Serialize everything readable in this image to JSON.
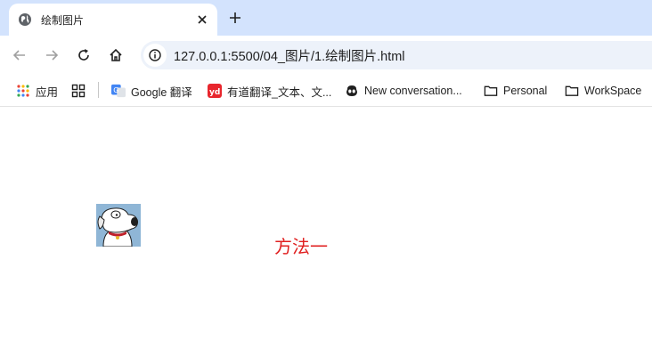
{
  "tab": {
    "title": "绘制图片"
  },
  "toolbar": {
    "url": "127.0.0.1:5500/04_图片/1.绘制图片.html"
  },
  "bookmarks": [
    {
      "label": "应用"
    },
    {
      "label": ""
    },
    {
      "label": "Google 翻译"
    },
    {
      "label": "有道翻译_文本、文..."
    },
    {
      "label": "New conversation..."
    },
    {
      "label": "Personal"
    },
    {
      "label": "WorkSpace"
    }
  ],
  "page": {
    "method_label": "方法一"
  },
  "colors": {
    "tabstrip": "#d3e3fd",
    "omnibox": "#edf2fa",
    "canvas_text": "#e02020"
  }
}
